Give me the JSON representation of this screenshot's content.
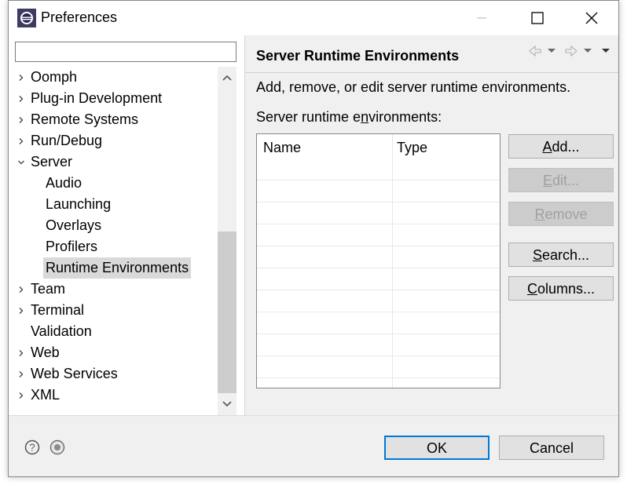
{
  "window": {
    "title": "Preferences"
  },
  "filter": {
    "value": "",
    "placeholder": ""
  },
  "tree": [
    {
      "label": "Oomph",
      "level": 0,
      "state": "collapsed"
    },
    {
      "label": "Plug-in Development",
      "level": 0,
      "state": "collapsed"
    },
    {
      "label": "Remote Systems",
      "level": 0,
      "state": "collapsed"
    },
    {
      "label": "Run/Debug",
      "level": 0,
      "state": "collapsed"
    },
    {
      "label": "Server",
      "level": 0,
      "state": "expanded"
    },
    {
      "label": "Audio",
      "level": 1,
      "state": "leaf"
    },
    {
      "label": "Launching",
      "level": 1,
      "state": "leaf"
    },
    {
      "label": "Overlays",
      "level": 1,
      "state": "leaf"
    },
    {
      "label": "Profilers",
      "level": 1,
      "state": "leaf"
    },
    {
      "label": "Runtime Environments",
      "level": 1,
      "state": "leaf",
      "selected": true
    },
    {
      "label": "Team",
      "level": 0,
      "state": "collapsed"
    },
    {
      "label": "Terminal",
      "level": 0,
      "state": "collapsed"
    },
    {
      "label": "Validation",
      "level": 0,
      "state": "leaf"
    },
    {
      "label": "Web",
      "level": 0,
      "state": "collapsed"
    },
    {
      "label": "Web Services",
      "level": 0,
      "state": "collapsed"
    },
    {
      "label": "XML",
      "level": 0,
      "state": "collapsed"
    }
  ],
  "page": {
    "title": "Server Runtime Environments",
    "description": "Add, remove, or edit server runtime environments.",
    "table_caption_pre": "Server runtime e",
    "table_caption_mnemonic": "n",
    "table_caption_post": "vironments:",
    "columns": [
      "Name",
      "Type"
    ]
  },
  "buttons": {
    "add": {
      "mnemonic": "A",
      "rest": "dd...",
      "enabled": true
    },
    "edit": {
      "mnemonic": "E",
      "rest": "dit...",
      "enabled": false
    },
    "remove": {
      "mnemonic": "R",
      "rest": "emove",
      "enabled": false
    },
    "search": {
      "mnemonic": "S",
      "rest": "earch...",
      "enabled": true
    },
    "columns": {
      "mnemonic": "C",
      "rest": "olumns...",
      "enabled": true
    }
  },
  "footer": {
    "ok_label": "OK",
    "cancel_label": "Cancel"
  },
  "colors": {
    "selection": "#d9d9d9",
    "ok_border": "#0078d7",
    "panel": "#f0f0f0"
  },
  "icons": {
    "app": "eclipse-app-icon",
    "help": "help-icon",
    "import": "import-export-icon",
    "back": "back-arrow-icon",
    "forward": "forward-arrow-icon"
  }
}
